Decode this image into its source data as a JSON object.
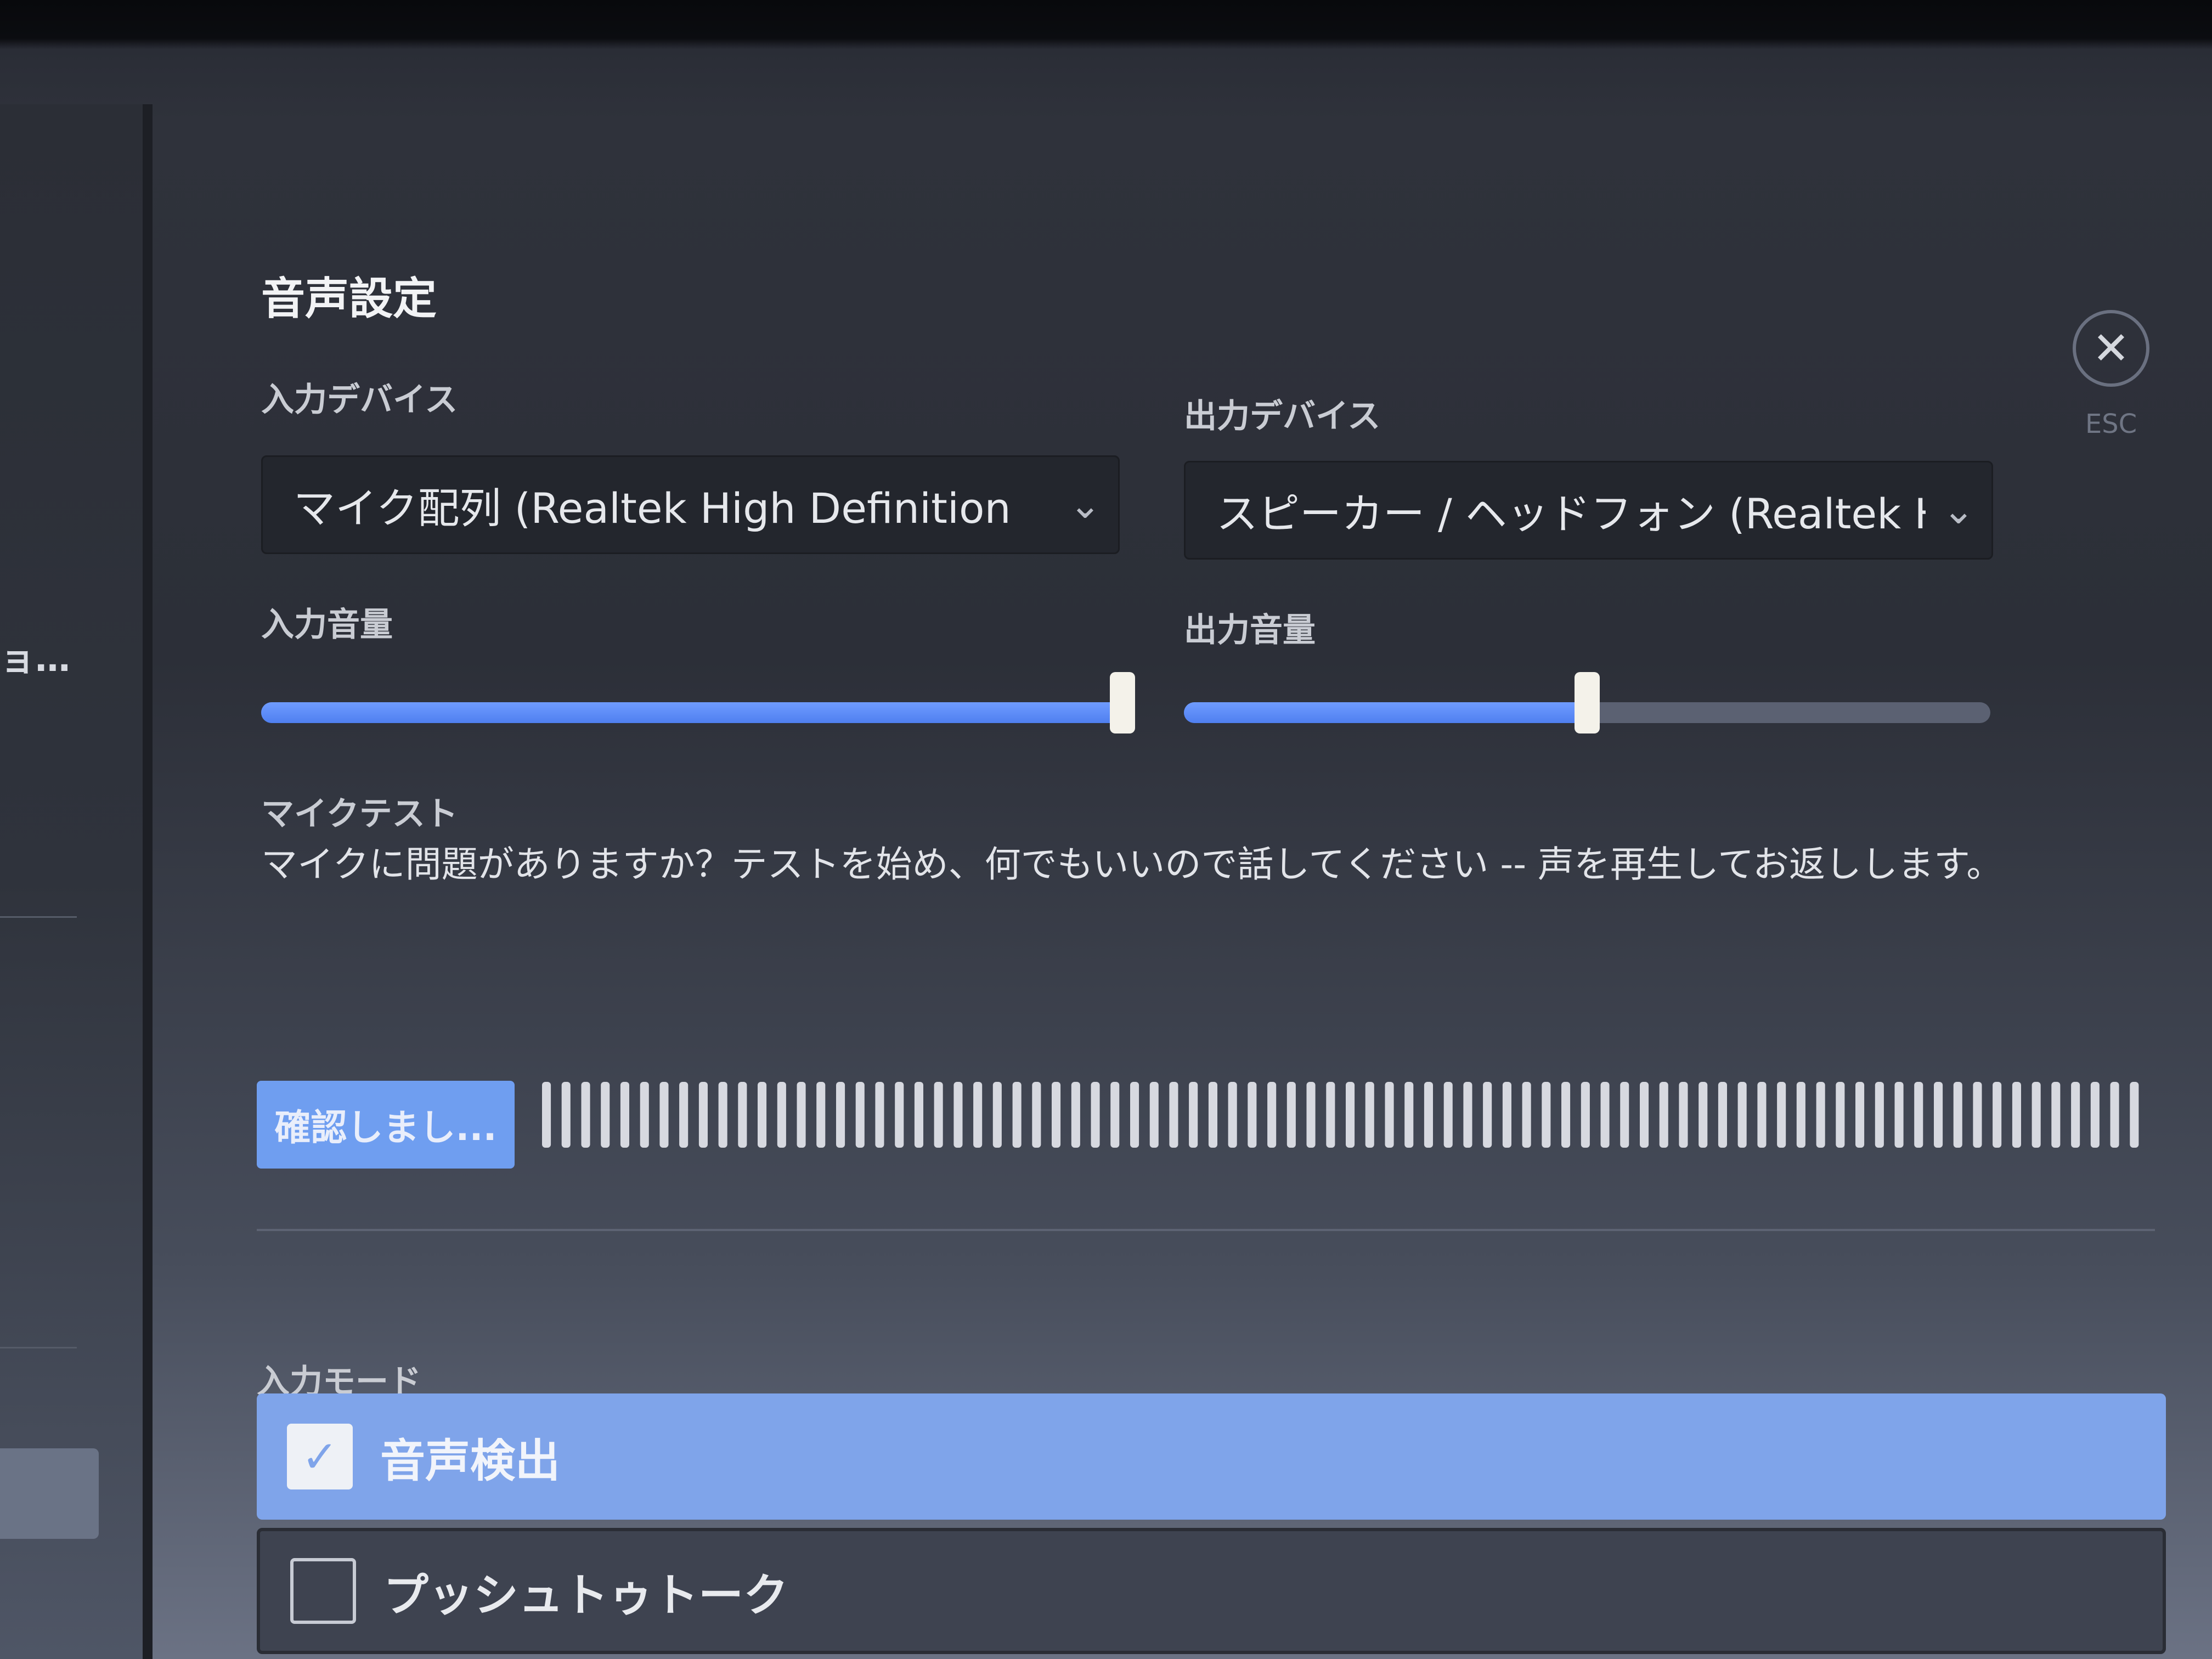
{
  "sidebar": {
    "truncated_item": "ョ…"
  },
  "panel": {
    "title": "音声設定",
    "close_hint": "ESC",
    "input_device": {
      "label": "入力デバイス",
      "value": "マイク配列 (Realtek High Definition"
    },
    "output_device": {
      "label": "出力デバイス",
      "value": "スピーカー / ヘッドフォン (Realtek High"
    },
    "input_volume": {
      "label": "入力音量",
      "level": 1.0
    },
    "output_volume": {
      "label": "出力音量",
      "level": 0.5
    },
    "mic_test": {
      "label": "マイクテスト",
      "description": "マイクに問題がありますか？テストを始め、何でもいいので話してください -- 声を再生してお返しします。",
      "button_label": "確認しまし..."
    },
    "input_mode": {
      "label": "入力モード",
      "options": [
        {
          "label": "音声検出",
          "selected": true
        },
        {
          "label": "プッシュトゥトーク",
          "selected": false
        }
      ]
    }
  },
  "colors": {
    "accent": "#6f9ef0",
    "selected_row": "#7fa4ea",
    "slider_fill": "#4f7ff0",
    "meter_bar": "#d7d9e0"
  }
}
